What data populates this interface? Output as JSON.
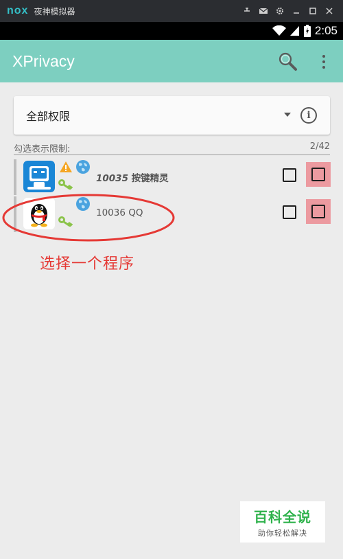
{
  "emulator": {
    "logo": "nox",
    "title": "夜神模拟器",
    "controls": {
      "pin_icon": "pin-icon",
      "mail_icon": "mail-icon",
      "settings_icon": "gear-icon",
      "minimize_icon": "minimize-icon",
      "maximize_icon": "maximize-icon",
      "close_icon": "close-icon"
    }
  },
  "status_bar": {
    "time": "2:05",
    "icons": [
      "wifi-icon",
      "signal-icon",
      "battery-icon"
    ]
  },
  "toolbar": {
    "title": "XPrivacy",
    "search_icon": "search-icon",
    "more_icon": "more-vert-icon",
    "color": "#7dcfc0"
  },
  "selector": {
    "label": "全部权限",
    "dropdown_icon": "dropdown-arrow-icon",
    "info_icon": "info-icon"
  },
  "filter": {
    "label": "勾选表示限制:",
    "count": "2/42"
  },
  "apps": [
    {
      "uid": "10035",
      "name": "按键精灵",
      "icon": "robot-app-icon",
      "badges": [
        "warning-icon",
        "globe-icon",
        "key-icon"
      ],
      "bold": true
    },
    {
      "uid": "10036",
      "name": "QQ",
      "icon": "qq-penguin-app-icon",
      "badges": [
        "globe-icon",
        "key-icon"
      ],
      "bold": false
    }
  ],
  "annotation": {
    "text": "选择一个程序",
    "color": "#e53935"
  },
  "watermark": {
    "main": "百科全说",
    "sub": "助你轻松解决"
  }
}
